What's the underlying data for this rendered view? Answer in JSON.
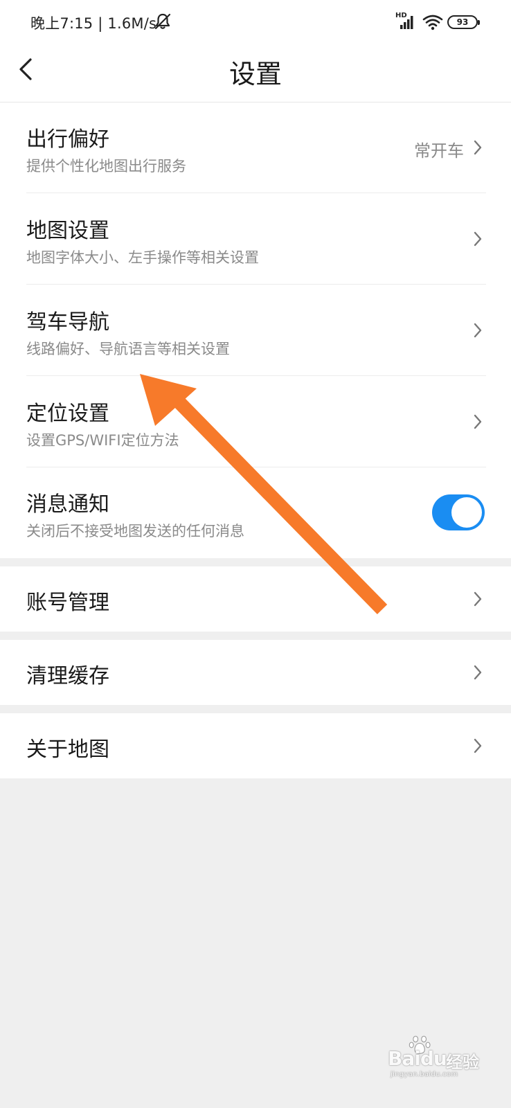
{
  "status_bar": {
    "time": "晚上7:15 | 1.6M/s",
    "network_label": "HD",
    "battery_level": "93",
    "icons": [
      "mute-icon",
      "signal-icon",
      "wifi-icon",
      "battery-icon"
    ]
  },
  "header": {
    "title": "设置",
    "back_icon": "chevron-left-icon"
  },
  "groups": [
    {
      "items": [
        {
          "title": "出行偏好",
          "subtitle": "提供个性化地图出行服务",
          "value": "常开车",
          "control": "chevron"
        },
        {
          "title": "地图设置",
          "subtitle": "地图字体大小、左手操作等相关设置",
          "control": "chevron"
        },
        {
          "title": "驾车导航",
          "subtitle": "线路偏好、导航语言等相关设置",
          "control": "chevron"
        },
        {
          "title": "定位设置",
          "subtitle": "设置GPS/WIFI定位方法",
          "control": "chevron"
        },
        {
          "title": "消息通知",
          "subtitle": "关闭后不接受地图发送的任何消息",
          "control": "toggle",
          "toggle_on": true
        }
      ]
    },
    {
      "items": [
        {
          "title": "账号管理",
          "control": "chevron"
        }
      ]
    },
    {
      "items": [
        {
          "title": "清理缓存",
          "control": "chevron"
        }
      ]
    },
    {
      "items": [
        {
          "title": "关于地图",
          "control": "chevron"
        }
      ]
    }
  ],
  "colors": {
    "accent": "#1a8df2",
    "annotation_arrow": "#f77a2a",
    "background": "#efefef",
    "surface": "#ffffff",
    "subtitle_text": "#8a8a8a"
  },
  "watermark": {
    "brand": "Baidu",
    "brand_cn": "经验",
    "url": "jingyan.baidu.com"
  }
}
